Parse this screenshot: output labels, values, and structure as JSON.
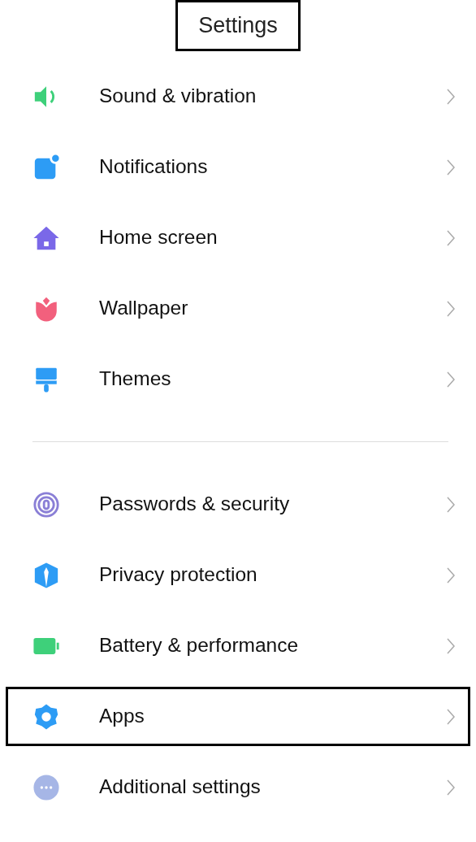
{
  "title": {
    "text": "Settings",
    "highlighted": true
  },
  "groups": [
    {
      "items": [
        {
          "label": "Sound & vibration",
          "kind": "sound",
          "highlighted": false
        },
        {
          "label": "Notifications",
          "kind": "notifications",
          "highlighted": false
        },
        {
          "label": "Home screen",
          "kind": "home",
          "highlighted": false
        },
        {
          "label": "Wallpaper",
          "kind": "wallpaper",
          "highlighted": false
        },
        {
          "label": "Themes",
          "kind": "themes",
          "highlighted": false
        }
      ]
    },
    {
      "items": [
        {
          "label": "Passwords & security",
          "kind": "passwords",
          "highlighted": false
        },
        {
          "label": "Privacy protection",
          "kind": "privacy",
          "highlighted": false
        },
        {
          "label": "Battery & performance",
          "kind": "battery",
          "highlighted": false
        },
        {
          "label": "Apps",
          "kind": "apps",
          "highlighted": true
        },
        {
          "label": "Additional settings",
          "kind": "more",
          "highlighted": false
        }
      ]
    }
  ]
}
